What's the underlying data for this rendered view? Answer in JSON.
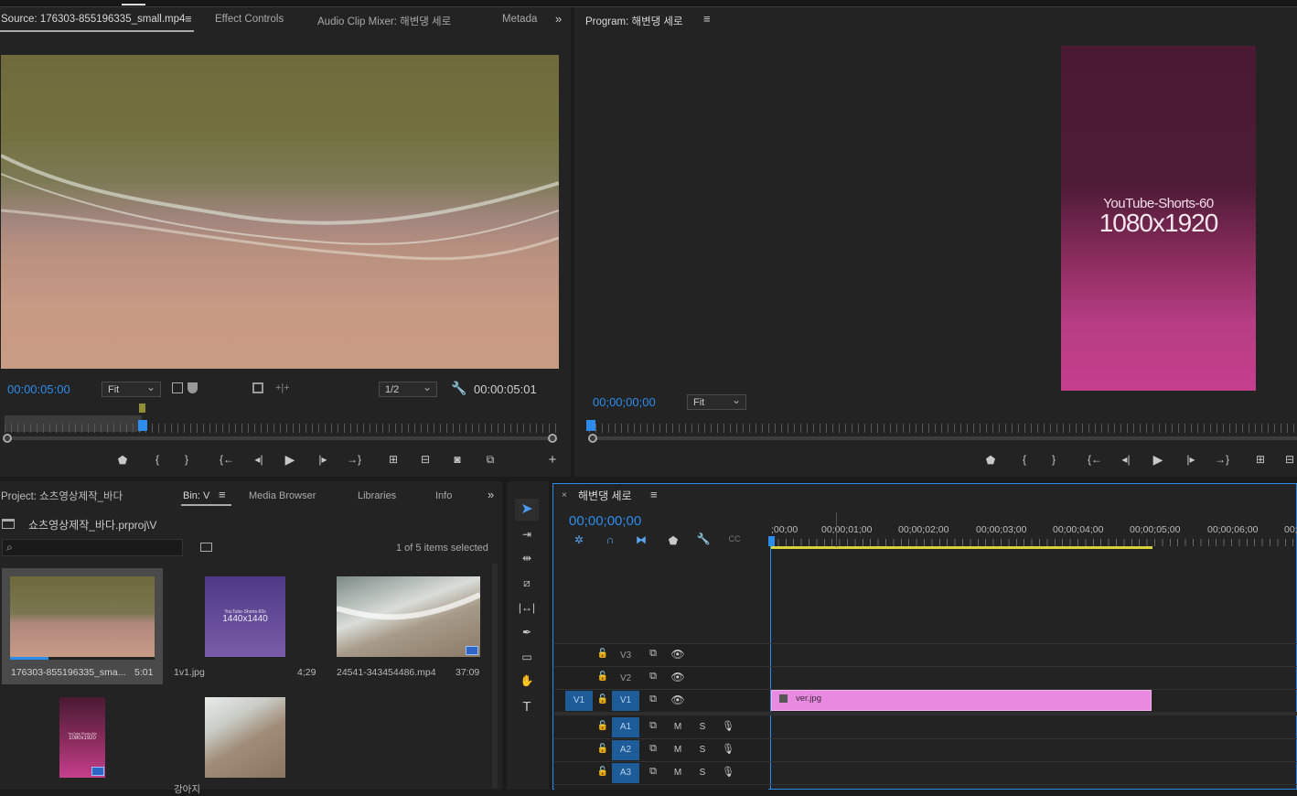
{
  "source_panel": {
    "tabs": [
      "Source: 176303-855196335_small.mp4",
      "Effect Controls",
      "Audio Clip Mixer: 해변댕 세로",
      "Metada"
    ],
    "timecode_current": "00:00:05:00",
    "fit": "Fit",
    "resolution": "1/2",
    "timecode_duration": "00:00:05:01"
  },
  "program_panel": {
    "title": "Program: 해변댕 세로",
    "timecode": "00;00;00;00",
    "fit": "Fit",
    "frame_line1": "YouTube-Shorts-60",
    "frame_line2": "1080x1920"
  },
  "project_panel": {
    "tabs": [
      "Project: 쇼츠영상제작_바다",
      "Bin: V",
      "Media Browser",
      "Libraries",
      "Info"
    ],
    "path": "쇼츠영상제작_바다.prproj\\V",
    "search_placeholder": "",
    "selection_status": "1 of 5 items selected",
    "items": [
      {
        "name": "176303-855196335_sma...",
        "duration": "5:01"
      },
      {
        "name": "1v1.jpg",
        "duration": "4;29",
        "thumb_line1": "YouTube-Shorts-60s",
        "thumb_line2": "1440x1440"
      },
      {
        "name": "24541-343454486.mp4",
        "duration": "37:09"
      },
      {
        "name": "",
        "duration": "",
        "thumb_line1": "YouTube-Shorts-60s",
        "thumb_line2": "1080x1920"
      },
      {
        "name": "강아지",
        "duration": ""
      }
    ]
  },
  "timeline": {
    "title": "해변댕 세로",
    "timecode": "00;00;00;00",
    "ruler_labels": [
      ";00;00",
      "00;00;01;00",
      "00;00;02;00",
      "00;00;03;00",
      "00;00;04;00",
      "00;00;05;00",
      "00;00;06;00",
      "00;"
    ],
    "video_tracks": [
      "V3",
      "V2",
      "V1"
    ],
    "source_patch": "V1",
    "audio_tracks": [
      "A1",
      "A2",
      "A3"
    ],
    "mute_label": "M",
    "solo_label": "S",
    "clip_name": "ver.jpg"
  },
  "colors": {
    "accent_blue": "#2d8ceb",
    "clip_pink": "#e88ae0",
    "frame_top": "#4a1a34",
    "frame_bottom": "#c63f8c"
  }
}
